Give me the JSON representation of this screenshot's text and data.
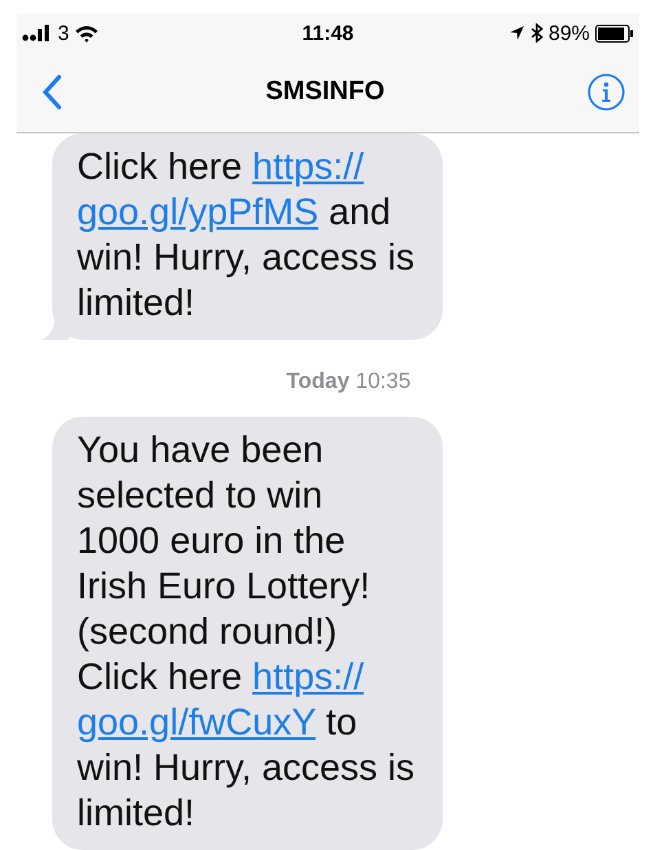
{
  "status_bar": {
    "carrier": "3",
    "time": "11:48",
    "battery": "89%"
  },
  "nav": {
    "title": "SMSINFO"
  },
  "messages": [
    {
      "kind": "received",
      "tail": true,
      "lines": [
        [
          {
            "kind": "text",
            "text": "Click here "
          },
          {
            "kind": "link",
            "text": "https://"
          }
        ],
        [
          {
            "kind": "link",
            "text": "goo.gl/ypPfMS"
          },
          {
            "kind": "text",
            "text": " and"
          }
        ],
        [
          {
            "kind": "text",
            "text": "win! Hurry, access is"
          }
        ],
        [
          {
            "kind": "text",
            "text": "limited!"
          }
        ]
      ]
    },
    {
      "kind": "timestamp",
      "day": "Today",
      "time": "10:35"
    },
    {
      "kind": "received",
      "tail": false,
      "lines": [
        [
          {
            "kind": "text",
            "text": "You have been"
          }
        ],
        [
          {
            "kind": "text",
            "text": "selected to win"
          }
        ],
        [
          {
            "kind": "text",
            "text": "1000 euro in the"
          }
        ],
        [
          {
            "kind": "text",
            "text": "Irish Euro Lottery!"
          }
        ],
        [
          {
            "kind": "text",
            "text": "(second round!)"
          }
        ],
        [
          {
            "kind": "text",
            "text": "Click here "
          },
          {
            "kind": "link",
            "text": "https://"
          }
        ],
        [
          {
            "kind": "link",
            "text": "goo.gl/fwCuxY"
          },
          {
            "kind": "text",
            "text": " to"
          }
        ],
        [
          {
            "kind": "text",
            "text": "win! Hurry, access is"
          }
        ],
        [
          {
            "kind": "text",
            "text": "limited!"
          }
        ]
      ]
    }
  ]
}
